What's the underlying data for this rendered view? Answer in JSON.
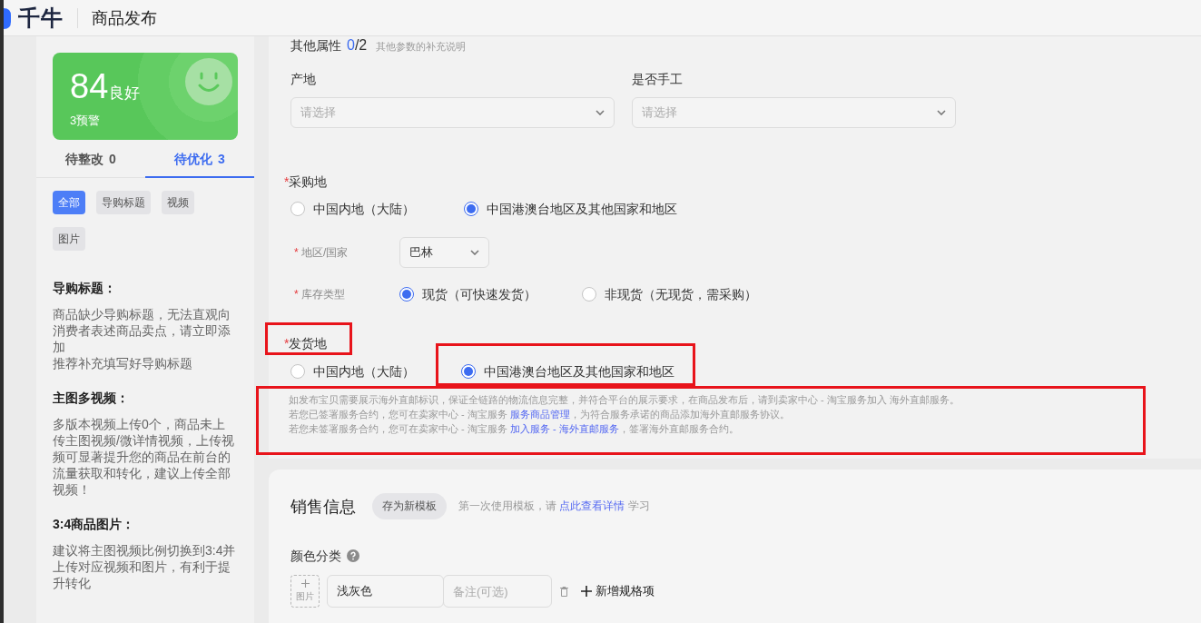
{
  "header": {
    "logo_text": "千牛",
    "page_title": "商品发布"
  },
  "sidebar": {
    "score": {
      "value": "84",
      "grade": "良好",
      "warnings": "3预警"
    },
    "tabs": [
      {
        "label": "待整改",
        "count": "0",
        "selected": false
      },
      {
        "label": "待优化",
        "count": "3",
        "selected": true
      }
    ],
    "filters": [
      {
        "label": "全部",
        "selected": true
      },
      {
        "label": "导购标题",
        "selected": false
      },
      {
        "label": "视频",
        "selected": false
      },
      {
        "label": "图片",
        "selected": false
      }
    ],
    "tips": [
      {
        "title": "导购标题：",
        "paragraphs": [
          "商品缺少导购标题，无法直观向消费者表述商品卖点，请立即添加",
          "推荐补充填写好导购标题"
        ]
      },
      {
        "title": "主图多视频：",
        "paragraphs": [
          "多版本视频上传0个，商品未上传主图视频/微详情视频，上传视频可显著提升您的商品在前台的流量获取和转化，建议上传全部视频！"
        ]
      },
      {
        "title": "3:4商品图片：",
        "paragraphs": [
          "建议将主图视频比例切换到3:4并上传对应视频和图片，有利于提升转化"
        ]
      }
    ]
  },
  "other_attributes": {
    "title": "其他属性",
    "filled": "0",
    "total": "/2",
    "hint": "其他参数的补充说明",
    "fields": [
      {
        "label": "产地",
        "placeholder": "请选择"
      },
      {
        "label": "是否手工",
        "placeholder": "请选择"
      }
    ]
  },
  "purchase_place": {
    "required_mark": "*",
    "label": "采购地",
    "options": [
      {
        "label": "中国内地（大陆）",
        "selected": false
      },
      {
        "label": "中国港澳台地区及其他国家和地区",
        "selected": true
      }
    ],
    "sub_fields": [
      {
        "kind": "select",
        "required_mark": "*",
        "label": "地区/国家",
        "value": "巴林"
      },
      {
        "kind": "radio",
        "required_mark": "*",
        "label": "库存类型",
        "options": [
          {
            "label": "现货（可快速发货）",
            "selected": true
          },
          {
            "label": "非现货（无现货，需采购）",
            "selected": false
          }
        ]
      }
    ]
  },
  "ship_from": {
    "required_mark": "*",
    "label": "发货地",
    "highlighted": true,
    "options": [
      {
        "label": "中国内地（大陆）",
        "selected": false,
        "highlighted": false
      },
      {
        "label": "中国港澳台地区及其他国家和地区",
        "selected": true,
        "highlighted": true
      }
    ],
    "notice": {
      "highlighted": true,
      "lines": [
        {
          "text": "如发布宝贝需要展示海外直邮标识，保证全链路的物流信息完整，并符合平台的展示要求，在商品发布后，请到卖家中心 - 淘宝服务加入 海外直邮服务。"
        },
        {
          "text": "若您已签署服务合约，您可在卖家中心 - 淘宝服务 ",
          "link": "服务商品管理",
          "after": "，为符合服务承诺的商品添加海外直邮服务协议。"
        },
        {
          "text": "若您未签署服务合约，您可在卖家中心 - 淘宝服务 ",
          "link": "加入服务 - 海外直邮服务",
          "after": "，签署海外直邮服务合约。"
        }
      ]
    }
  },
  "sales_info": {
    "title": "销售信息",
    "save_template_button": "存为新模板",
    "template_hint": {
      "text": "第一次使用模板，请 ",
      "link": "点此查看详情",
      "after": " 学习"
    },
    "color_category": {
      "label": "颜色分类",
      "items": [
        {
          "image_label": "图片",
          "name": "浅灰色",
          "note_placeholder": "备注(可选)"
        }
      ],
      "add_button": "新增规格项"
    }
  }
}
